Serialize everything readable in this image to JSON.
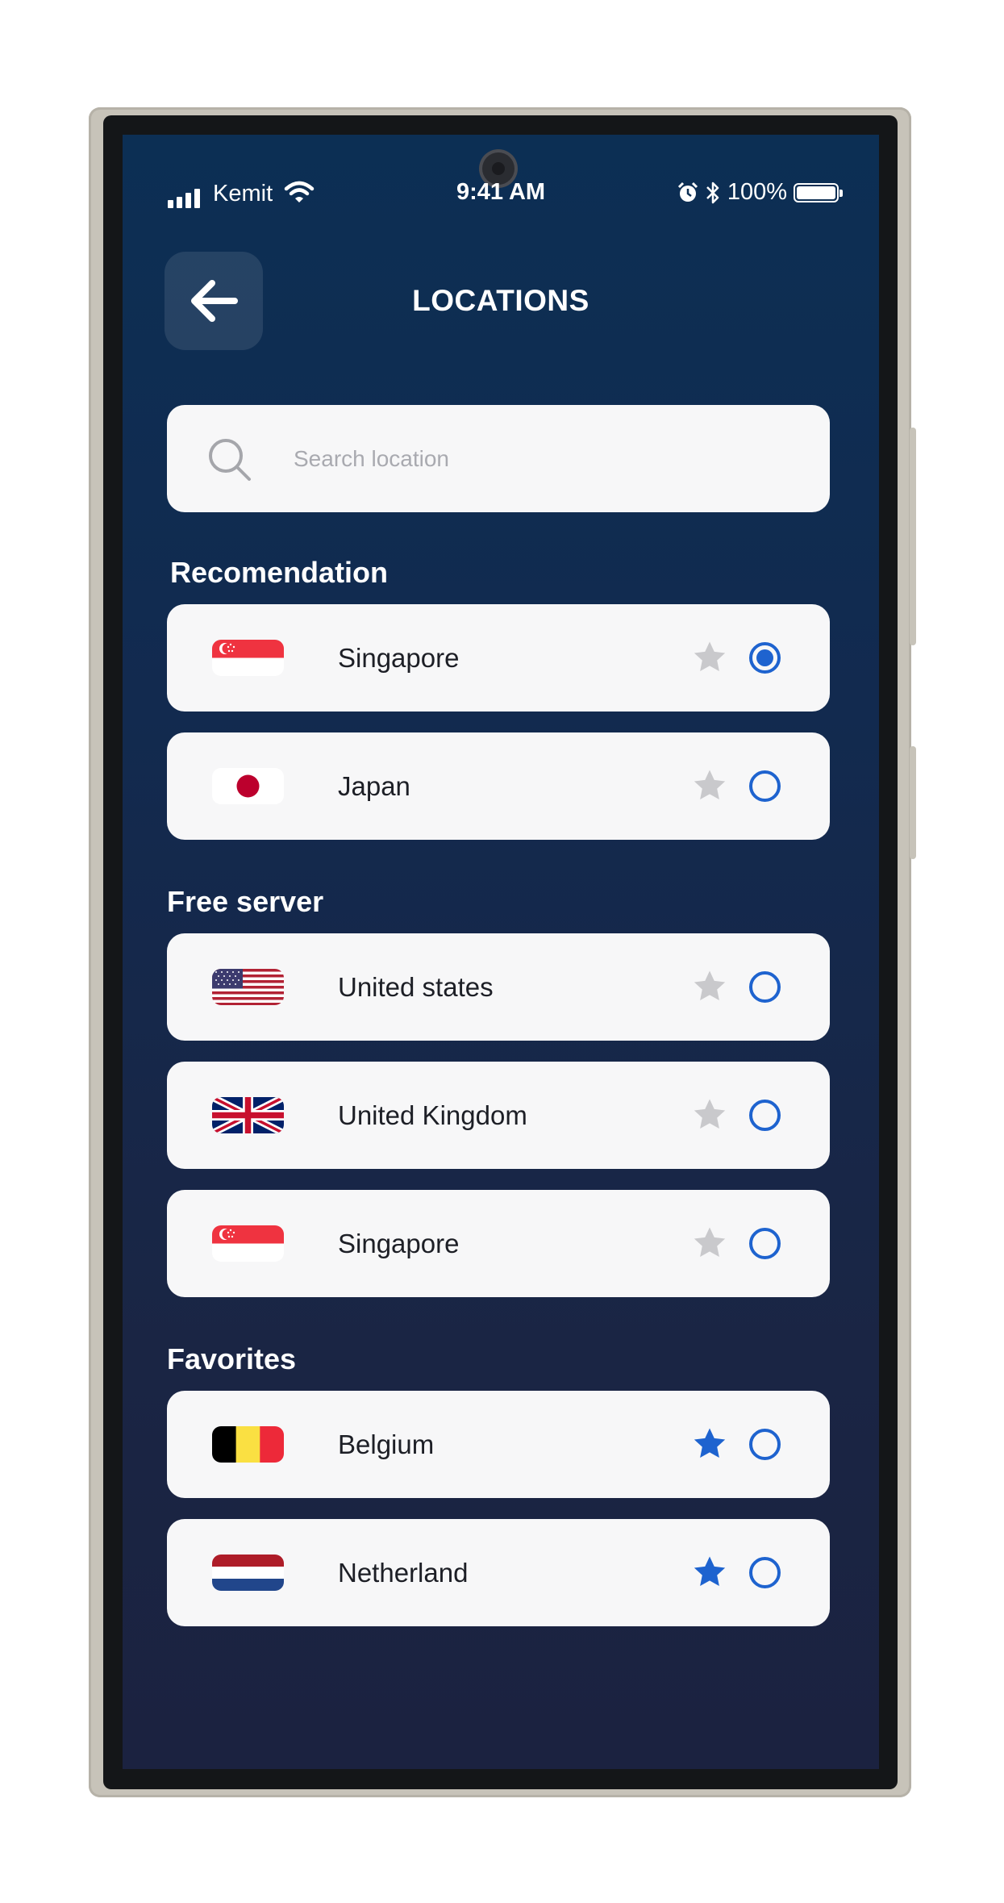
{
  "status_bar": {
    "carrier": "Kemit",
    "time": "9:41 AM",
    "battery": "100%"
  },
  "header": {
    "title": "LOCATIONS"
  },
  "search": {
    "placeholder": "Search location",
    "value": ""
  },
  "colors": {
    "accent": "#1e63cf",
    "star_inactive": "#c9c9cc",
    "background_top": "#0c2f54",
    "background_bottom": "#1b2240",
    "card": "#f7f7f8"
  },
  "sections": [
    {
      "title": "Recomendation",
      "items": [
        {
          "name": "Singapore",
          "flag": "singapore-flag",
          "favorite": false,
          "selected": true
        },
        {
          "name": "Japan",
          "flag": "japan-flag",
          "favorite": false,
          "selected": false
        }
      ]
    },
    {
      "title": "Free server",
      "items": [
        {
          "name": "United states",
          "flag": "usa-flag",
          "favorite": false,
          "selected": false
        },
        {
          "name": "United Kingdom",
          "flag": "uk-flag",
          "favorite": false,
          "selected": false
        },
        {
          "name": "Singapore",
          "flag": "singapore-flag",
          "favorite": false,
          "selected": false
        }
      ]
    },
    {
      "title": "Favorites",
      "items": [
        {
          "name": "Belgium",
          "flag": "belgium-flag",
          "favorite": true,
          "selected": false
        },
        {
          "name": "Netherland",
          "flag": "netherlands-flag",
          "favorite": true,
          "selected": false
        }
      ]
    }
  ]
}
